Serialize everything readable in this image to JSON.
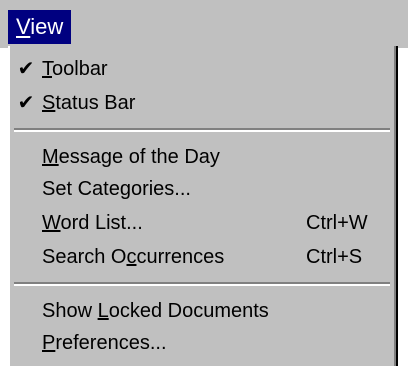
{
  "menu": {
    "title": "View",
    "items": [
      {
        "label": "Toolbar",
        "checked": true
      },
      {
        "label": "Status Bar",
        "checked": true
      },
      {
        "label": "Message of the Day"
      },
      {
        "label": "Set Categories..."
      },
      {
        "label": "Word List...",
        "shortcut": "Ctrl+W"
      },
      {
        "label": "Search Occurrences",
        "shortcut": "Ctrl+S"
      },
      {
        "label": "Show Locked Documents"
      },
      {
        "label": "Preferences..."
      }
    ],
    "check_glyph": "✔"
  },
  "colors": {
    "menu_bg": "#c0c0c0",
    "title_highlight": "#000080",
    "title_text": "#ffffff"
  }
}
